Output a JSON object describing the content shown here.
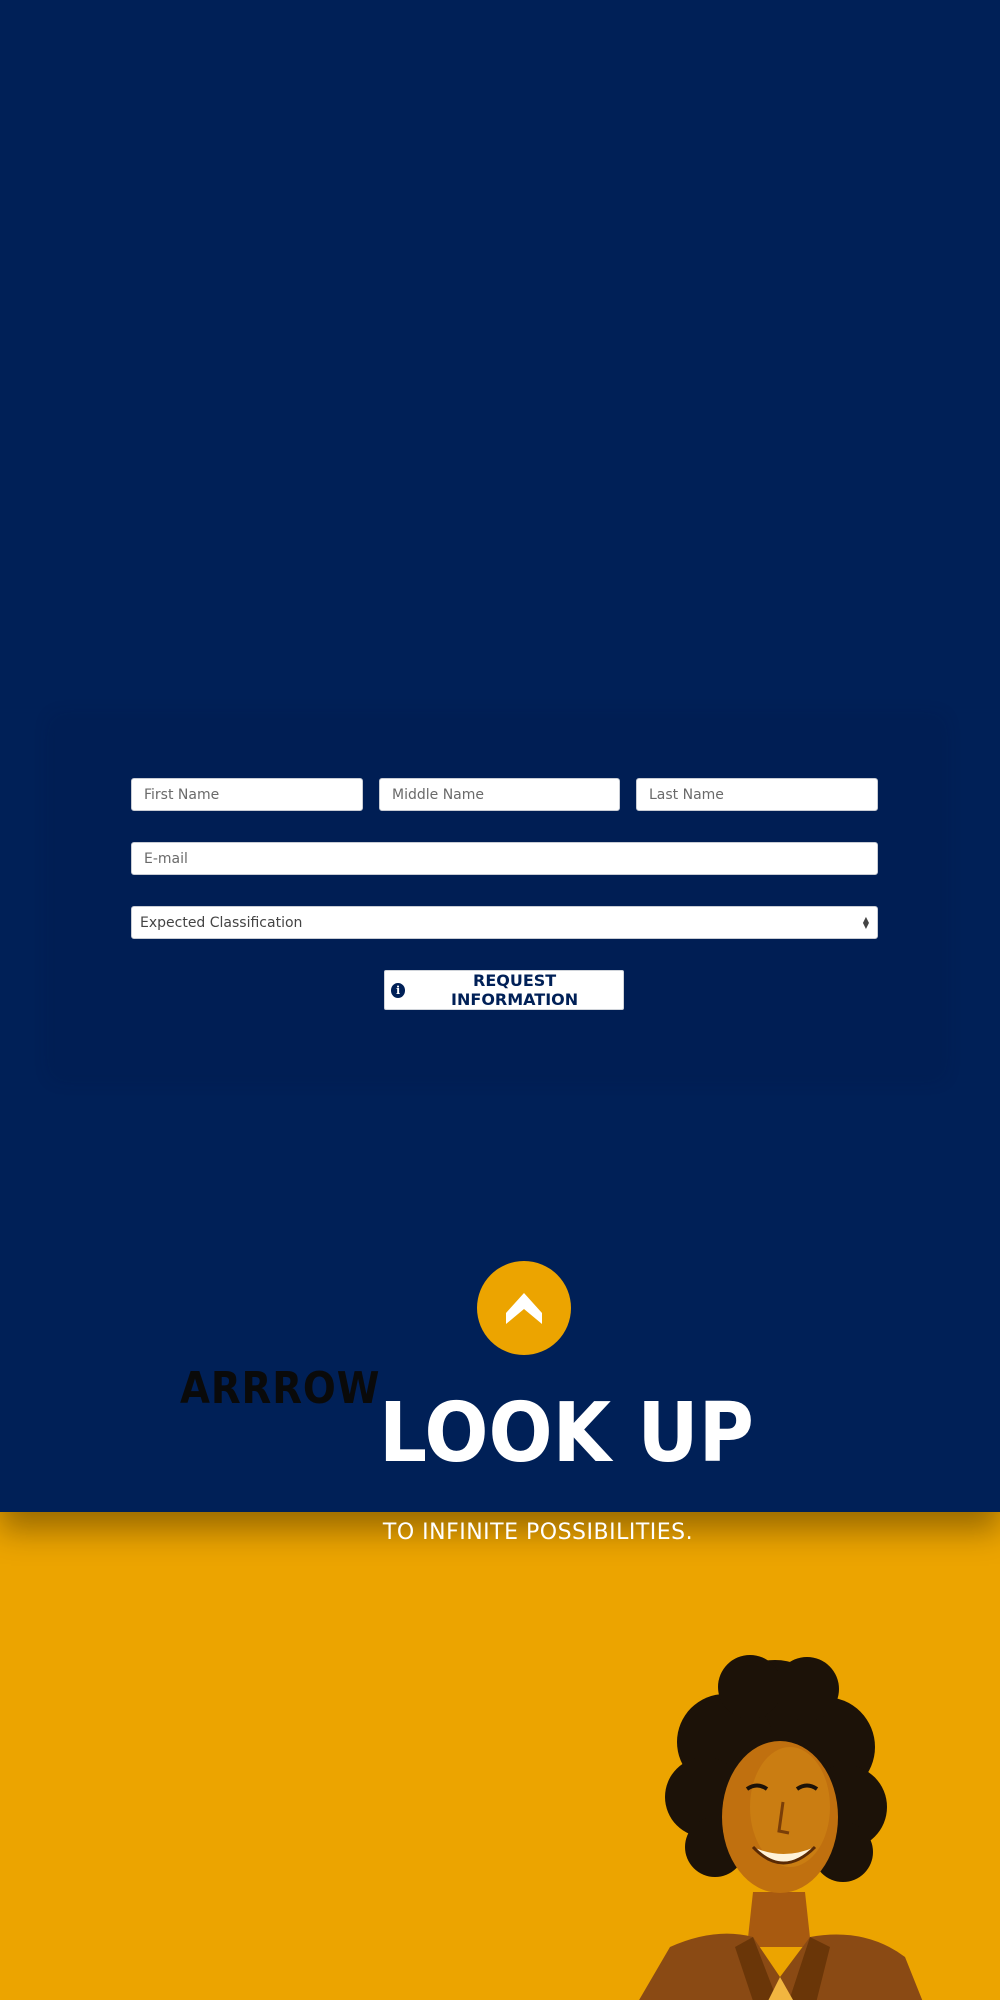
{
  "form": {
    "first_name_placeholder": "First Name",
    "middle_name_placeholder": "Middle Name",
    "last_name_placeholder": "Last Name",
    "email_placeholder": "E-mail",
    "classification_selected": "Expected Classification",
    "submit_label": "REQUEST INFORMATION"
  },
  "hero": {
    "logo_text": "ARRROW",
    "headline": "LOOK UP",
    "tagline": "TO INFINITE POSSIBILITIES."
  },
  "icons": {
    "info": "info-circle-icon",
    "arrow_up": "chevron-up-icon"
  },
  "colors": {
    "navy": "#002057",
    "gold": "#eca400",
    "white": "#ffffff"
  }
}
